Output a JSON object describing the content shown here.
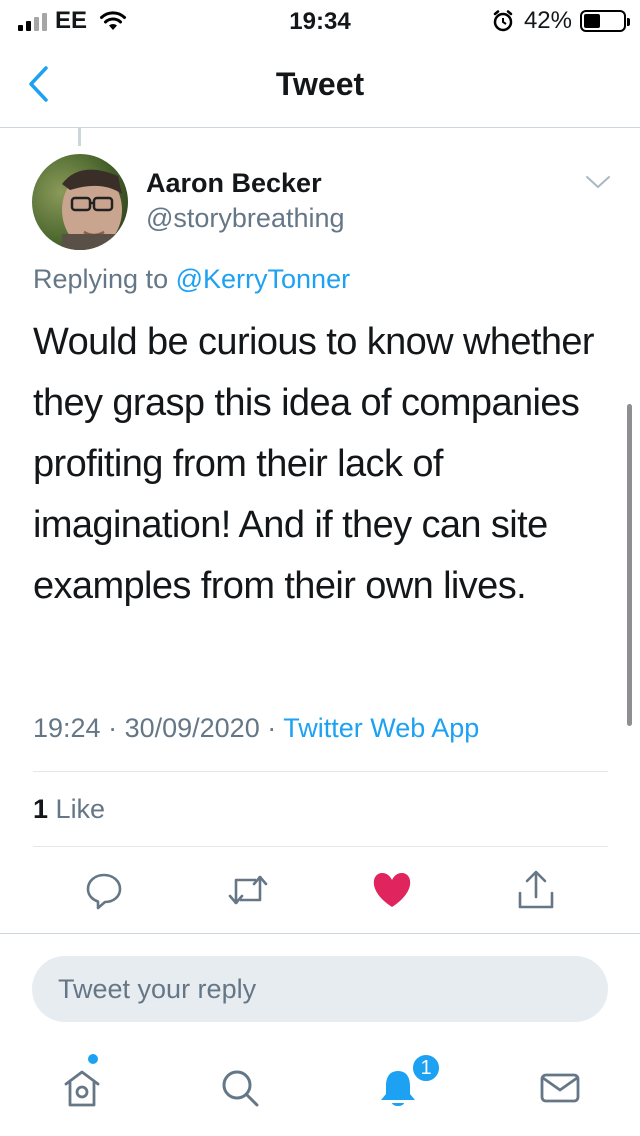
{
  "status_bar": {
    "carrier": "EE",
    "time": "19:34",
    "battery_percent": "42%",
    "battery_level": 0.42,
    "icons": [
      "signal-icon",
      "wifi-icon",
      "alarm-icon",
      "battery-icon"
    ]
  },
  "nav": {
    "title": "Tweet",
    "back_icon": "chevron-left-icon"
  },
  "tweet": {
    "author_name": "Aaron Becker",
    "author_handle": "@storybreathing",
    "replying_prefix": "Replying to",
    "replying_to": "@KerryTonner",
    "text": "Would be curious to know whether they grasp this idea of companies profiting from their lack of imagination! And if they can site examples from their own lives.",
    "time": "19:24",
    "date": "30/09/2020",
    "source": "Twitter Web App",
    "separator": " · ",
    "likes_count": "1",
    "likes_label": "Like",
    "liked": true
  },
  "actions": [
    "reply-icon",
    "retweet-icon",
    "like-icon",
    "share-icon"
  ],
  "reply_box": {
    "placeholder": "Tweet your reply"
  },
  "tab_bar": {
    "tabs": [
      "home-icon",
      "search-icon",
      "notifications-icon",
      "messages-icon"
    ],
    "notifications_badge": "1"
  },
  "colors": {
    "accent": "#1da1f2",
    "like": "#e0245e",
    "secondary_text": "#657786",
    "divider": "#ccd6dd"
  }
}
